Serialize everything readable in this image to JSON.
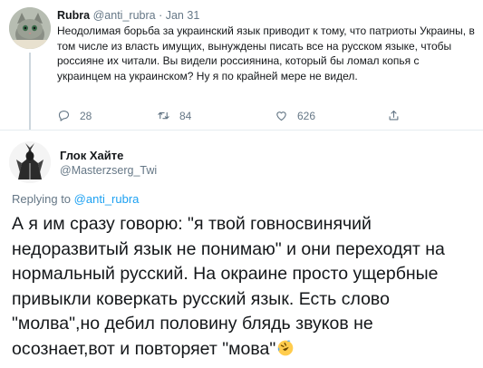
{
  "parent_tweet": {
    "author_name": "Rubra",
    "author_handle": "@anti_rubra",
    "separator": "·",
    "date": "Jan 31",
    "text": "Неодолимая борьба за украинский язык приводит к тому, что патриоты Украины, в том числе из власть имущих, вынуждены писать все на русском языке, чтобы россияне их читали. Вы видели россиянина, который бы ломал копья с украинцем на украинском? Ну я по крайней мере не видел.",
    "actions": {
      "reply": {
        "icon": "reply-icon",
        "count": "28"
      },
      "retweet": {
        "icon": "retweet-icon",
        "count": "84"
      },
      "like": {
        "icon": "heart-icon",
        "count": "626"
      },
      "share": {
        "icon": "share-icon"
      }
    }
  },
  "reply_tweet": {
    "author_name": "Глок Хайте",
    "author_handle": "@Masterzserg_Twi",
    "replying_prefix": "Replying to",
    "replying_to": "@anti_rubra",
    "text": "А я им сразу говорю: \"я твой говносвинячий недоразвитый язык не понимаю\" и они переходят на нормальный русский. На окраине просто ущербные привыкли коверкать русский язык. Есть слово \"молва\",но дебил половину блядь звуков не осознает,вот и повторяет \"мова\"",
    "emoji": "rolling-on-floor-laughing-emoji"
  },
  "colors": {
    "text_primary": "#14171a",
    "text_secondary": "#657786",
    "link": "#1da1f2",
    "divider": "#e6ecf0",
    "thread_line": "#ccd6dd"
  }
}
